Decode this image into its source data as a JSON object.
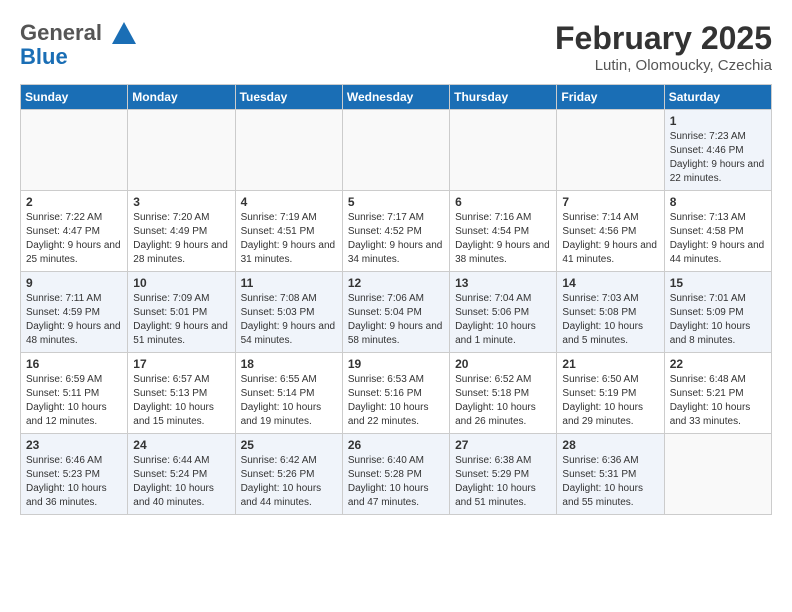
{
  "logo": {
    "line1": "General",
    "line2": "Blue"
  },
  "header": {
    "title": "February 2025",
    "subtitle": "Lutin, Olomoucky, Czechia"
  },
  "days_of_week": [
    "Sunday",
    "Monday",
    "Tuesday",
    "Wednesday",
    "Thursday",
    "Friday",
    "Saturday"
  ],
  "weeks": [
    [
      {
        "day": "",
        "info": ""
      },
      {
        "day": "",
        "info": ""
      },
      {
        "day": "",
        "info": ""
      },
      {
        "day": "",
        "info": ""
      },
      {
        "day": "",
        "info": ""
      },
      {
        "day": "",
        "info": ""
      },
      {
        "day": "1",
        "info": "Sunrise: 7:23 AM\nSunset: 4:46 PM\nDaylight: 9 hours and 22 minutes."
      }
    ],
    [
      {
        "day": "2",
        "info": "Sunrise: 7:22 AM\nSunset: 4:47 PM\nDaylight: 9 hours and 25 minutes."
      },
      {
        "day": "3",
        "info": "Sunrise: 7:20 AM\nSunset: 4:49 PM\nDaylight: 9 hours and 28 minutes."
      },
      {
        "day": "4",
        "info": "Sunrise: 7:19 AM\nSunset: 4:51 PM\nDaylight: 9 hours and 31 minutes."
      },
      {
        "day": "5",
        "info": "Sunrise: 7:17 AM\nSunset: 4:52 PM\nDaylight: 9 hours and 34 minutes."
      },
      {
        "day": "6",
        "info": "Sunrise: 7:16 AM\nSunset: 4:54 PM\nDaylight: 9 hours and 38 minutes."
      },
      {
        "day": "7",
        "info": "Sunrise: 7:14 AM\nSunset: 4:56 PM\nDaylight: 9 hours and 41 minutes."
      },
      {
        "day": "8",
        "info": "Sunrise: 7:13 AM\nSunset: 4:58 PM\nDaylight: 9 hours and 44 minutes."
      }
    ],
    [
      {
        "day": "9",
        "info": "Sunrise: 7:11 AM\nSunset: 4:59 PM\nDaylight: 9 hours and 48 minutes."
      },
      {
        "day": "10",
        "info": "Sunrise: 7:09 AM\nSunset: 5:01 PM\nDaylight: 9 hours and 51 minutes."
      },
      {
        "day": "11",
        "info": "Sunrise: 7:08 AM\nSunset: 5:03 PM\nDaylight: 9 hours and 54 minutes."
      },
      {
        "day": "12",
        "info": "Sunrise: 7:06 AM\nSunset: 5:04 PM\nDaylight: 9 hours and 58 minutes."
      },
      {
        "day": "13",
        "info": "Sunrise: 7:04 AM\nSunset: 5:06 PM\nDaylight: 10 hours and 1 minute."
      },
      {
        "day": "14",
        "info": "Sunrise: 7:03 AM\nSunset: 5:08 PM\nDaylight: 10 hours and 5 minutes."
      },
      {
        "day": "15",
        "info": "Sunrise: 7:01 AM\nSunset: 5:09 PM\nDaylight: 10 hours and 8 minutes."
      }
    ],
    [
      {
        "day": "16",
        "info": "Sunrise: 6:59 AM\nSunset: 5:11 PM\nDaylight: 10 hours and 12 minutes."
      },
      {
        "day": "17",
        "info": "Sunrise: 6:57 AM\nSunset: 5:13 PM\nDaylight: 10 hours and 15 minutes."
      },
      {
        "day": "18",
        "info": "Sunrise: 6:55 AM\nSunset: 5:14 PM\nDaylight: 10 hours and 19 minutes."
      },
      {
        "day": "19",
        "info": "Sunrise: 6:53 AM\nSunset: 5:16 PM\nDaylight: 10 hours and 22 minutes."
      },
      {
        "day": "20",
        "info": "Sunrise: 6:52 AM\nSunset: 5:18 PM\nDaylight: 10 hours and 26 minutes."
      },
      {
        "day": "21",
        "info": "Sunrise: 6:50 AM\nSunset: 5:19 PM\nDaylight: 10 hours and 29 minutes."
      },
      {
        "day": "22",
        "info": "Sunrise: 6:48 AM\nSunset: 5:21 PM\nDaylight: 10 hours and 33 minutes."
      }
    ],
    [
      {
        "day": "23",
        "info": "Sunrise: 6:46 AM\nSunset: 5:23 PM\nDaylight: 10 hours and 36 minutes."
      },
      {
        "day": "24",
        "info": "Sunrise: 6:44 AM\nSunset: 5:24 PM\nDaylight: 10 hours and 40 minutes."
      },
      {
        "day": "25",
        "info": "Sunrise: 6:42 AM\nSunset: 5:26 PM\nDaylight: 10 hours and 44 minutes."
      },
      {
        "day": "26",
        "info": "Sunrise: 6:40 AM\nSunset: 5:28 PM\nDaylight: 10 hours and 47 minutes."
      },
      {
        "day": "27",
        "info": "Sunrise: 6:38 AM\nSunset: 5:29 PM\nDaylight: 10 hours and 51 minutes."
      },
      {
        "day": "28",
        "info": "Sunrise: 6:36 AM\nSunset: 5:31 PM\nDaylight: 10 hours and 55 minutes."
      },
      {
        "day": "",
        "info": ""
      }
    ]
  ]
}
